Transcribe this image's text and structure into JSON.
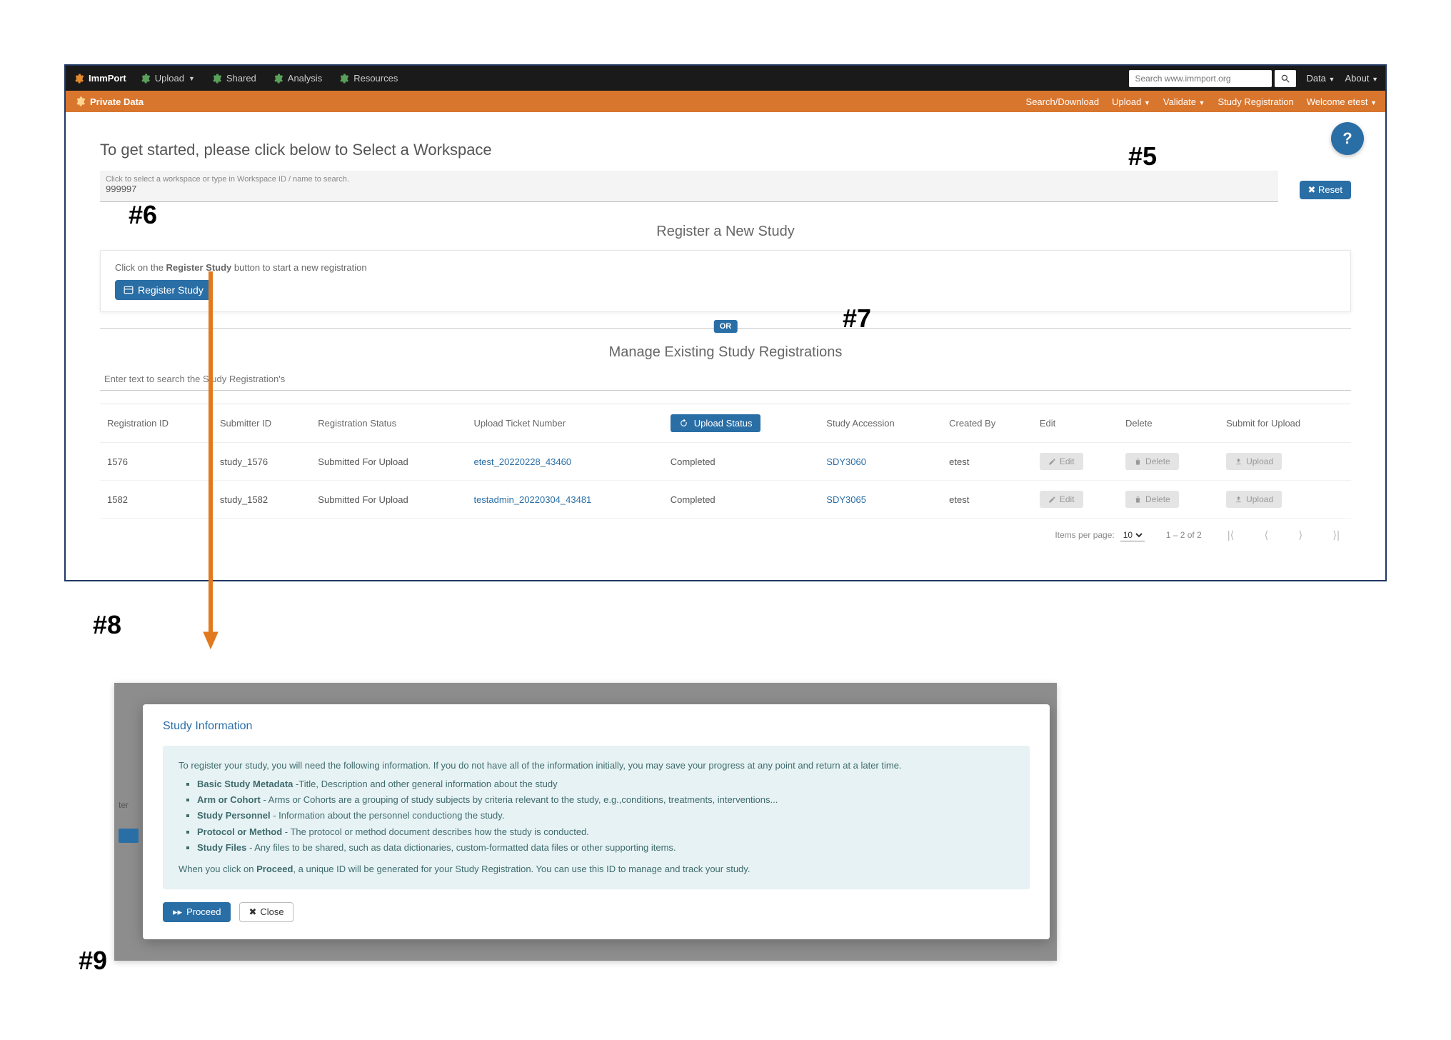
{
  "topnav": {
    "brand": "ImmPort",
    "items": [
      "Upload",
      "Shared",
      "Analysis",
      "Resources"
    ],
    "search_placeholder": "Search www.immport.org",
    "right": [
      "Data",
      "About"
    ]
  },
  "ribbon": {
    "title": "Private Data",
    "links": [
      "Search/Download",
      "Upload",
      "Validate",
      "Study Registration",
      "Welcome etest"
    ]
  },
  "page": {
    "title_prefix": "To get started, please click below to ",
    "title_emph": "Select a Workspace",
    "ws_label": "Click to select a workspace or type in Workspace ID / name to search.",
    "ws_value": "999997",
    "reset": "Reset",
    "section1": "Register a New Study",
    "instr_prefix": "Click on the ",
    "instr_strong": "Register Study",
    "instr_suffix": " button to start a new registration",
    "register_btn": "Register Study",
    "or": "OR",
    "section2": "Manage Existing Study Registrations",
    "search_placeholder": "Enter text to search the Study Registration's"
  },
  "annotations": {
    "a5": "#5",
    "a6": "#6",
    "a7": "#7",
    "a8": "#8",
    "a9": "#9"
  },
  "table": {
    "headers": {
      "reg_id": "Registration ID",
      "sub_id": "Submitter ID",
      "reg_status": "Registration Status",
      "ticket": "Upload Ticket Number",
      "up_status": "Upload Status",
      "accession": "Study Accession",
      "created": "Created By",
      "edit": "Edit",
      "delete": "Delete",
      "submit": "Submit for Upload"
    },
    "rows": [
      {
        "reg_id": "1576",
        "sub_id": "study_1576",
        "reg_status": "Submitted For Upload",
        "ticket": "etest_20220228_43460",
        "up_status": "Completed",
        "accession": "SDY3060",
        "created": "etest"
      },
      {
        "reg_id": "1582",
        "sub_id": "study_1582",
        "reg_status": "Submitted For Upload",
        "ticket": "testadmin_20220304_43481",
        "up_status": "Completed",
        "accession": "SDY3065",
        "created": "etest"
      }
    ],
    "btns": {
      "edit": "Edit",
      "delete": "Delete",
      "upload": "Upload"
    },
    "pager": {
      "per_label": "Items per page:",
      "per_value": "10",
      "range": "1 – 2 of 2"
    }
  },
  "modal": {
    "title": "Study Information",
    "intro": "To register your study, you will need the following information. If you do not have all of the information initially, you may save your progress at any point and return at a later time.",
    "bullets": [
      {
        "strong": "Basic Study Metadata",
        "rest": " -Title, Description and other general information about the study"
      },
      {
        "strong": "Arm or Cohort",
        "rest": " - Arms or Cohorts are a grouping of study subjects by criteria relevant to the study, e.g.,conditions, treatments, interventions..."
      },
      {
        "strong": "Study Personnel",
        "rest": " - Information about the personnel conductiong the study."
      },
      {
        "strong": "Protocol or Method",
        "rest": " - The protocol or method document describes how the study is conducted."
      },
      {
        "strong": "Study Files",
        "rest": " - Any files to be shared, such as data dictionaries, custom-formatted data files or other supporting items."
      }
    ],
    "outro_a": "When you click on ",
    "outro_strong": "Proceed",
    "outro_b": ", a unique ID will be generated for your Study Registration. You can use this ID to manage and track your study.",
    "proceed": "Proceed",
    "close": "Close",
    "side_text": "ter"
  }
}
